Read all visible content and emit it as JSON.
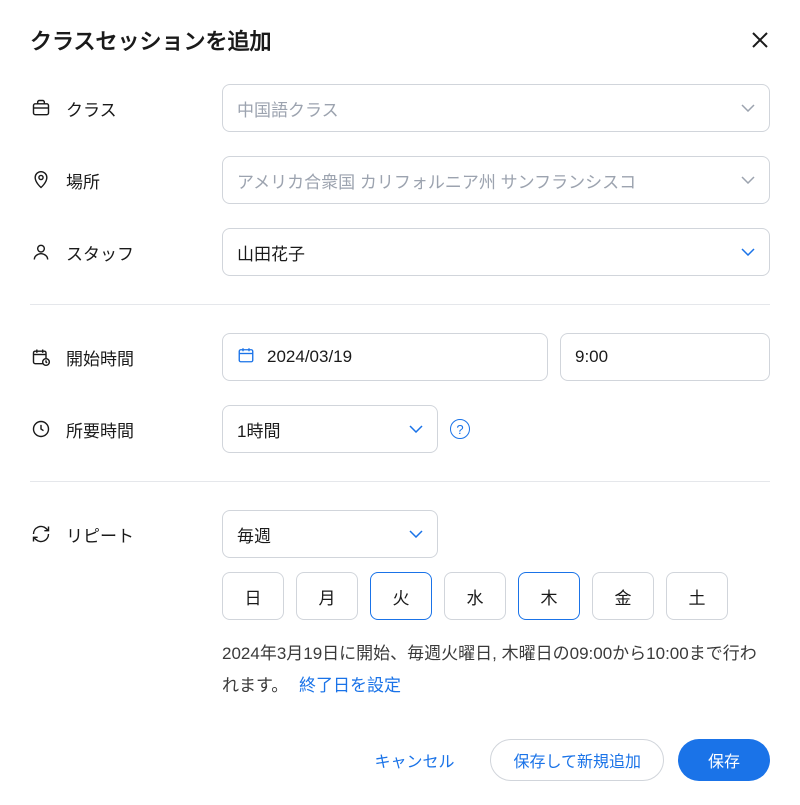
{
  "title": "クラスセッションを追加",
  "labels": {
    "class": "クラス",
    "location": "場所",
    "staff": "スタッフ",
    "start_time": "開始時間",
    "duration": "所要時間",
    "repeat": "リピート"
  },
  "fields": {
    "class_placeholder": "中国語クラス",
    "location_placeholder": "アメリカ合衆国 カリフォルニア州 サンフランシスコ",
    "staff_value": "山田花子",
    "date_value": "2024/03/19",
    "time_value": "9:00",
    "duration_value": "1時間",
    "repeat_value": "毎週"
  },
  "days": [
    {
      "label": "日",
      "selected": false
    },
    {
      "label": "月",
      "selected": false
    },
    {
      "label": "火",
      "selected": true
    },
    {
      "label": "水",
      "selected": false
    },
    {
      "label": "木",
      "selected": true
    },
    {
      "label": "金",
      "selected": false
    },
    {
      "label": "土",
      "selected": false
    }
  ],
  "summary": {
    "text": "2024年3月19日に開始、毎週火曜日, 木曜日の09:00から10:00まで行われます。",
    "link": "終了日を設定"
  },
  "buttons": {
    "cancel": "キャンセル",
    "save_new": "保存して新規追加",
    "save": "保存"
  },
  "colors": {
    "primary": "#1a73e8",
    "border": "#d1d5db",
    "placeholder": "#9ca3af"
  }
}
